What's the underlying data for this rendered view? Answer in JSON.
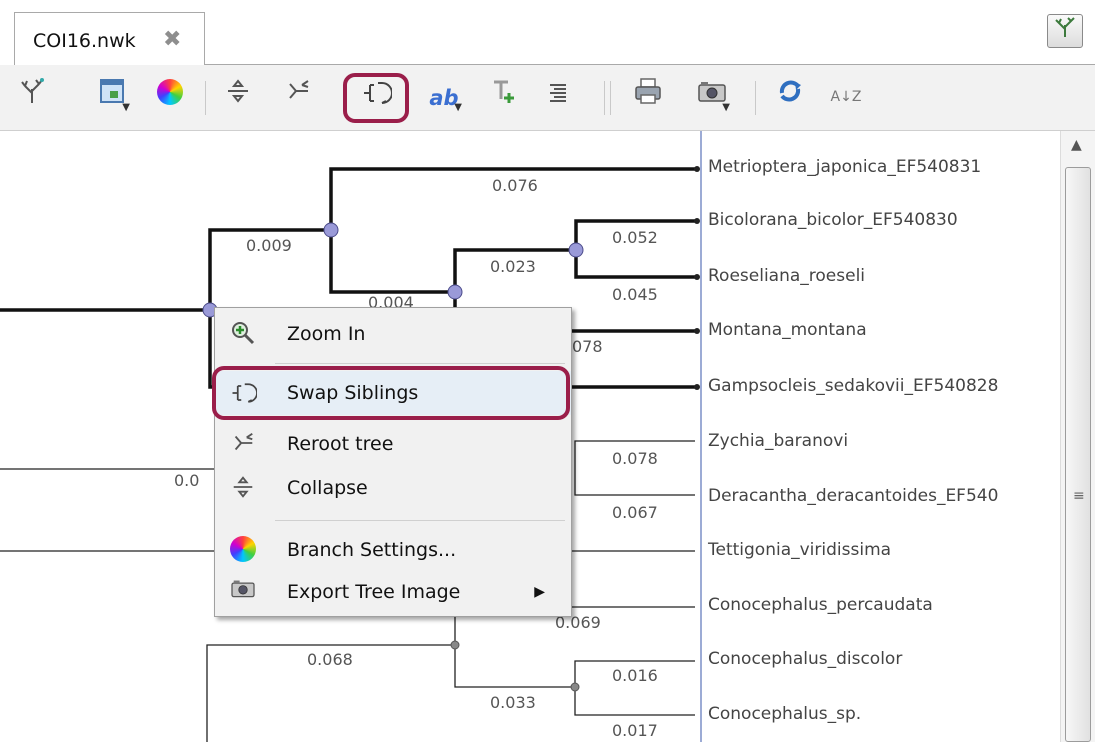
{
  "tab": {
    "title": "COI16.nwk"
  },
  "toolbar": {
    "buttons": [
      {
        "name": "tree-layout-icon"
      },
      {
        "name": "select-layout-icon"
      },
      {
        "name": "branch-color-icon"
      },
      {
        "name": "collapse-icon"
      },
      {
        "name": "reroot-icon"
      },
      {
        "name": "swap-siblings-icon"
      },
      {
        "name": "labels-ab-icon",
        "text": "ab"
      },
      {
        "name": "add-text-icon"
      },
      {
        "name": "align-text-icon"
      },
      {
        "name": "print-icon"
      },
      {
        "name": "export-image-icon"
      },
      {
        "name": "refresh-icon"
      },
      {
        "name": "sort-az-icon",
        "text": "A↓Z"
      }
    ]
  },
  "tree": {
    "leaves": [
      "Metrioptera_japonica_EF540831",
      "Bicolorana_bicolor_EF540830",
      "Roeseliana_roeseli",
      "Montana_montana",
      "Gampsocleis_sedakovii_EF540828",
      "Zychia_baranovi",
      "Deracantha_deracantoides_EF540",
      "Tettigonia_viridissima",
      "Conocephalus_percaudata",
      "Conocephalus_discolor",
      "Conocephalus_sp."
    ],
    "branch_lengths": {
      "metrioptera": "0.076",
      "upper_clade": "0.009",
      "bicolorana": "0.052",
      "bicolor_roeseli_node": "0.023",
      "roeseliana": "0.045",
      "montana_partial": "078",
      "inner_node": "0.004",
      "zychia": "0.078",
      "deracantha": "0.067",
      "left_partial": "0.0",
      "percaudata_partial": "0.069",
      "lower_clade": "0.068",
      "discolor": "0.016",
      "discolor_sp_node": "0.033",
      "conocephalus_sp": "0.017"
    }
  },
  "context_menu": {
    "items": [
      {
        "label": "Zoom In",
        "icon": "zoom-in-icon"
      },
      {
        "label": "Swap Siblings",
        "icon": "swap-siblings-icon"
      },
      {
        "label": "Reroot tree",
        "icon": "reroot-icon"
      },
      {
        "label": "Collapse",
        "icon": "collapse-icon"
      },
      {
        "label": "Branch Settings...",
        "icon": "branch-color-icon"
      },
      {
        "label": "Export Tree Image",
        "icon": "camera-icon",
        "submenu": "▶"
      }
    ]
  },
  "colors": {
    "highlight": "#9a1e4a",
    "node": "#9a9ad8",
    "accent_line": "#7c8fc7"
  }
}
